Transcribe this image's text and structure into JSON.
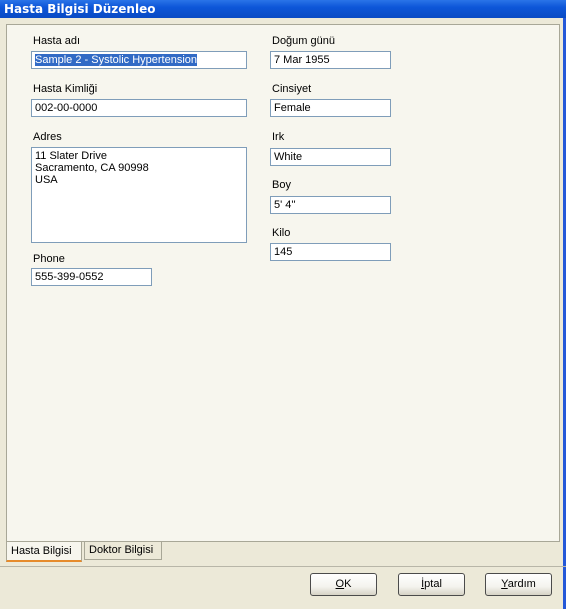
{
  "window": {
    "title": "Hasta Bilgisi Düzenleo"
  },
  "form": {
    "name_label": "Hasta adı",
    "name_value": "Sample 2 - Systolic Hypertension",
    "id_label": "Hasta Kimliği",
    "id_value": "002-00-0000",
    "address_label": "Adres",
    "address_lines": [
      "11 Slater Drive",
      "Sacramento, CA 90998",
      "USA"
    ],
    "phone_label": "Phone",
    "phone_value": "555-399-0552",
    "dob_label": "Doğum günü",
    "dob_value": "7 Mar 1955",
    "gender_label": "Cinsiyet",
    "gender_value": "Female",
    "race_label": "Irk",
    "race_value": "White",
    "height_label": "Boy",
    "height_value": "5' 4''",
    "weight_label": "Kilo",
    "weight_value": "145"
  },
  "tabs": {
    "patient": "Hasta Bilgisi",
    "doctor": "Doktor Bilgisi"
  },
  "buttons": {
    "ok_mnemonic": "O",
    "ok_rest": "K",
    "cancel_mnemonic": "İ",
    "cancel_rest": "ptal",
    "help_mnemonic": "Y",
    "help_rest": "ardım"
  },
  "colors": {
    "titlebar": "#0a4bc4",
    "selection": "#316ac5",
    "active_tab_accent": "#e68b2c"
  }
}
